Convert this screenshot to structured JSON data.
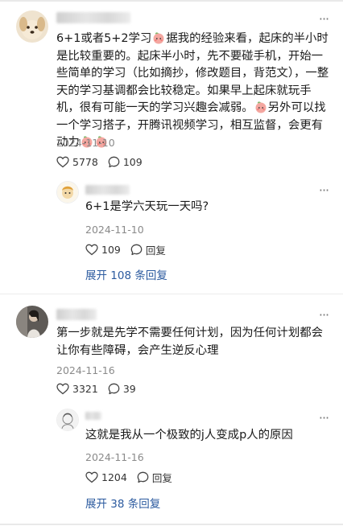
{
  "comments": [
    {
      "text_parts": [
        "6+1或者5+2学习",
        "据我的经验来看，起床的半小时是比较重要的。起床半小时，先不要碰手机，开始一些简单的学习（比如摘抄，修改题目，背范文），一整天的学习基调都会比较稳定。如果早上起床就玩手机，很有可能一天的学习兴趣会减弱。",
        "另外可以找一个学习搭子，开腾讯视频学习，相互监督，会更有动力"
      ],
      "date": "2024-11-10",
      "likes": "5778",
      "replies": "109",
      "reply": {
        "text": "6+1是学六天玩一天吗?",
        "date": "2024-11-10",
        "likes": "109",
        "reply_label": "回复"
      },
      "expand": "展开 108 条回复"
    },
    {
      "text": "第一步就是先学不需要任何计划，因为任何计划都会让你有些障碍，会产生逆反心理",
      "date": "2024-11-16",
      "likes": "3321",
      "replies": "39",
      "reply": {
        "text": "这就是我从一个极致的j人变成p人的原因",
        "date": "2024-11-16",
        "likes": "1204",
        "reply_label": "回复"
      },
      "expand": "展开 38 条回复"
    }
  ],
  "icons": {
    "heart": "heart-icon",
    "comment": "comment-icon",
    "more": "more-icon",
    "emoji": "peach-face-emoji"
  },
  "colors": {
    "link": "#2b5a9f",
    "date": "#8a8a8a",
    "text": "#1a1a1a"
  }
}
